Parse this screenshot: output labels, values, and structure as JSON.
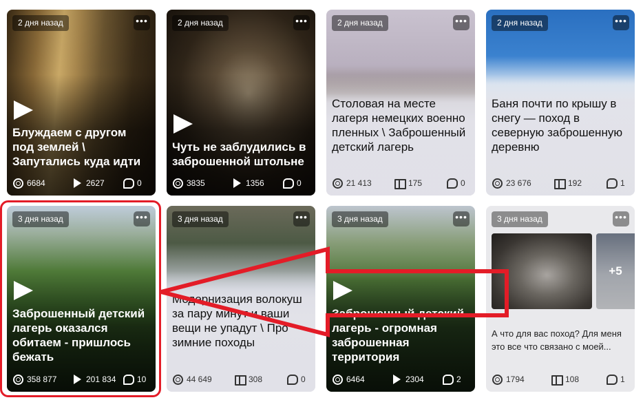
{
  "cards": [
    {
      "date": "2 дня назад",
      "title": "Блуждаем с другом под землей \\ Запутались куда идти",
      "views": "6684",
      "plays": "2627",
      "comments": "0"
    },
    {
      "date": "2 дня назад",
      "title": "Чуть не заблудились в заброшенной штольне",
      "views": "3835",
      "plays": "1356",
      "comments": "0"
    },
    {
      "date": "2 дня назад",
      "title": "Столовая на месте лагеря немецких военно пленных \\ Заброшенный детский лагерь",
      "views": "21 413",
      "reads": "175",
      "comments": "0"
    },
    {
      "date": "2 дня назад",
      "title": "Баня почти по крышу в снегу — поход в северную заброшенную деревню",
      "views": "23 676",
      "reads": "192",
      "comments": "1"
    },
    {
      "date": "3 дня назад",
      "title": "Заброшенный детский лагерь оказался обитаем - пришлось бежать",
      "views": "358 877",
      "plays": "201 834",
      "comments": "10"
    },
    {
      "date": "3 дня назад",
      "title": "Модернизация волокуш за пару минут и ваши вещи не упадут \\ Про зимние походы",
      "views": "44 649",
      "reads": "308",
      "comments": "0"
    },
    {
      "date": "3 дня назад",
      "title": "Заброшенный детский лагерь - огромная заброшенная территория",
      "views": "6464",
      "plays": "2304",
      "comments": "2"
    },
    {
      "date": "3 дня назад",
      "more": "+5",
      "text": "А что для вас поход? Для меня это все что связано с моей...",
      "views": "1794",
      "reads": "108",
      "comments": "1"
    }
  ],
  "menu_glyph": "•••",
  "annotation_color": "#e31c27"
}
